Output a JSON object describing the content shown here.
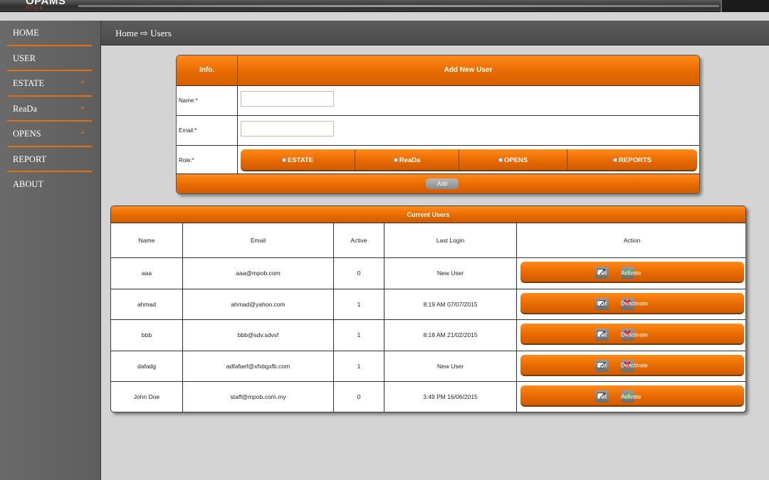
{
  "app": {
    "logo": "OPAMS",
    "logo_sub": "MPOB"
  },
  "sidebar": {
    "items": [
      {
        "label": "HOME",
        "expandable": false
      },
      {
        "label": "USER",
        "expandable": false
      },
      {
        "label": "ESTATE",
        "expandable": true,
        "expand_glyph": "+"
      },
      {
        "label": "ReaDa",
        "expandable": true,
        "expand_glyph": "+"
      },
      {
        "label": "OPENS",
        "expandable": true,
        "expand_glyph": "+"
      },
      {
        "label": "REPORT",
        "expandable": false
      },
      {
        "label": "ABOUT",
        "expandable": false
      }
    ]
  },
  "breadcrumb": {
    "text": "Home ⇨ Users"
  },
  "add_user": {
    "info_header": "Info.",
    "title": "Add New User",
    "name_label": "Name:*",
    "name_value": "",
    "email_label": "Email:*",
    "email_value": "",
    "role_label": "Role:*",
    "roles": [
      "ESTATE",
      "ReaDa",
      "OPENS",
      "REPORTS"
    ],
    "add_button": "Add"
  },
  "current_users": {
    "title": "Current Users",
    "columns": [
      "Name",
      "Email",
      "Active",
      "Last Login",
      "Action"
    ],
    "rows": [
      {
        "name": "aaa",
        "email": "aaa@mpob.com",
        "active": "0",
        "last_login": "New User",
        "edit": "Edit",
        "toggle": "Activate",
        "toggle_icon": "check-icon"
      },
      {
        "name": "ahmad",
        "email": "ahmad@yahoo.com",
        "active": "1",
        "last_login": "8:19 AM 07/07/2015",
        "edit": "Edit",
        "toggle": "Deactivate",
        "toggle_icon": "cross-icon"
      },
      {
        "name": "bbb",
        "email": "bbb@sdv.sdvsf",
        "active": "1",
        "last_login": "8:18 AM 21/02/2015",
        "edit": "Edit",
        "toggle": "Deactivate",
        "toggle_icon": "cross-icon"
      },
      {
        "name": "dafadg",
        "email": "adfafaef@xfxbgxfb.com",
        "active": "1",
        "last_login": "New User",
        "edit": "Edit",
        "toggle": "Deactivate",
        "toggle_icon": "cross-icon"
      },
      {
        "name": "John Doe",
        "email": "staff@mpob.com.my",
        "active": "0",
        "last_login": "3:49 PM 16/06/2015",
        "edit": "Edit",
        "toggle": "Activate",
        "toggle_icon": "check-icon"
      }
    ]
  },
  "colors": {
    "accent": "#e86a00",
    "sidebar": "#656565",
    "page_bg": "#d4d4d4"
  }
}
